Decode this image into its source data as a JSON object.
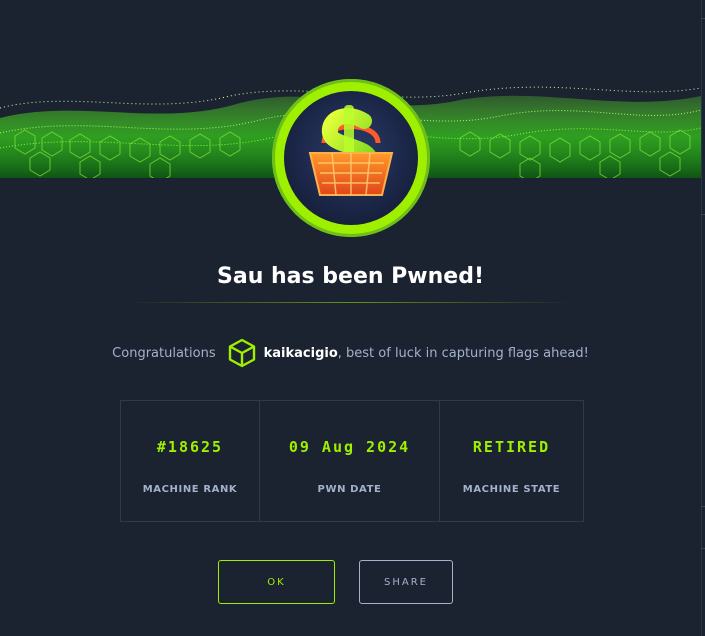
{
  "modal": {
    "title": "Sau has been Pwned!",
    "congrats_prefix": "Congratulations",
    "username": "kaikacigio",
    "congrats_suffix": ", best of luck in capturing flags ahead!",
    "avatar_icon": "shopping-basket-dollar-icon",
    "user_icon": "hackthebox-cube-icon"
  },
  "stats": [
    {
      "value": "#18625",
      "label": "MACHINE RANK"
    },
    {
      "value": "09 Aug 2024",
      "label": "PWN DATE"
    },
    {
      "value": "RETIRED",
      "label": "MACHINE STATE"
    }
  ],
  "buttons": {
    "ok_label": "OK",
    "share_label": "SHARE"
  },
  "colors": {
    "accent": "#9fef00",
    "background": "#1b2230",
    "muted_text": "#a4b1cd",
    "border": "#313a4a"
  }
}
